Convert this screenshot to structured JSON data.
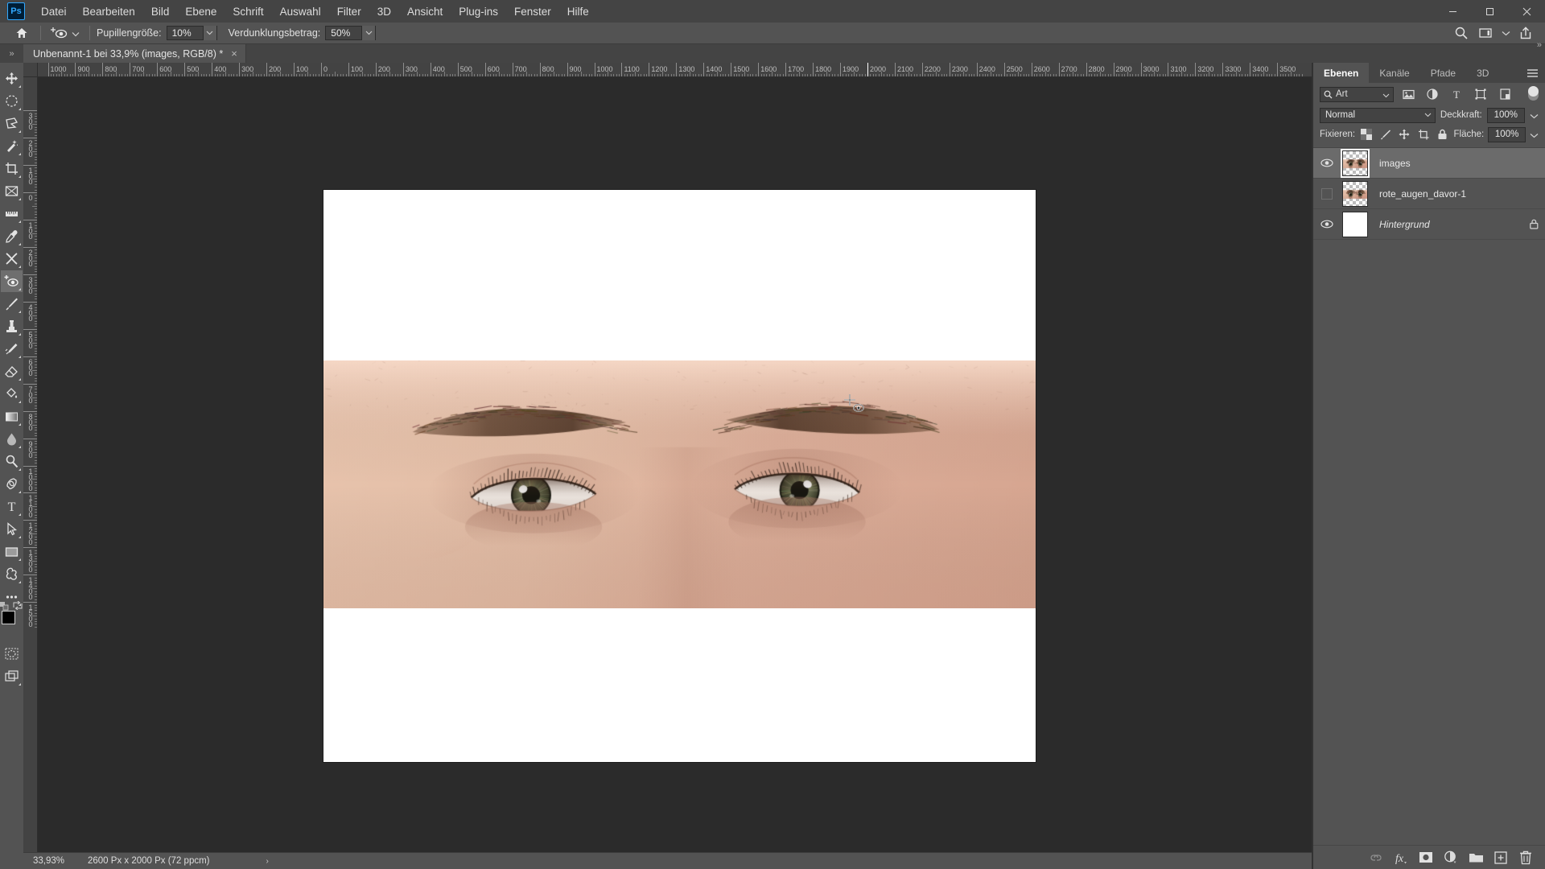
{
  "app": {
    "logo": "Ps",
    "menus": [
      "Datei",
      "Bearbeiten",
      "Bild",
      "Ebene",
      "Schrift",
      "Auswahl",
      "Filter",
      "3D",
      "Ansicht",
      "Plug-ins",
      "Fenster",
      "Hilfe"
    ],
    "window_controls": [
      "minimize",
      "maximize",
      "close"
    ]
  },
  "options_bar": {
    "home_icon": "home-icon",
    "tool_icon": "red-eye-tool-icon",
    "tool_preset_caret": "chevron-down-icon",
    "pupil_size_label": "Pupillengröße:",
    "pupil_size_value": "10%",
    "darken_label": "Verdunklungsbetrag:",
    "darken_value": "50%",
    "right_icons": [
      "search-icon",
      "workspace-icon",
      "chevron-down-icon",
      "share-icon"
    ]
  },
  "document_tab": {
    "title": "Unbenannt-1 bei 33,9% (images, RGB/8) *",
    "close": "×",
    "collapse_left": "»",
    "collapse_right": "»"
  },
  "toolbar": {
    "tools": [
      {
        "name": "move-tool",
        "glyph": "move",
        "active": false
      },
      {
        "name": "marquee-tool",
        "glyph": "marquee",
        "active": false
      },
      {
        "name": "lasso-tool",
        "glyph": "lasso",
        "active": false
      },
      {
        "name": "quick-selection-tool",
        "glyph": "wand",
        "active": false
      },
      {
        "name": "crop-tool",
        "glyph": "crop",
        "active": false
      },
      {
        "name": "frame-tool",
        "glyph": "frame",
        "active": false
      },
      {
        "name": "ruler-tool",
        "glyph": "ruler",
        "active": false
      },
      {
        "name": "eyedropper-tool",
        "glyph": "eyedropper",
        "active": false
      },
      {
        "name": "healing-brush-tool",
        "glyph": "heal",
        "active": false
      },
      {
        "name": "red-eye-tool",
        "glyph": "redeye",
        "active": true
      },
      {
        "name": "brush-tool",
        "glyph": "brush",
        "active": false
      },
      {
        "name": "clone-stamp-tool",
        "glyph": "stamp",
        "active": false
      },
      {
        "name": "history-brush-tool",
        "glyph": "historybrush",
        "active": false
      },
      {
        "name": "eraser-tool",
        "glyph": "eraser",
        "active": false
      },
      {
        "name": "gradient-tool",
        "glyph": "paintbucket",
        "active": false
      },
      {
        "name": "gradient-fill-tool",
        "glyph": "gradient",
        "active": false
      },
      {
        "name": "blur-tool",
        "glyph": "blur",
        "active": false
      },
      {
        "name": "dodge-tool",
        "glyph": "dodge",
        "active": false
      },
      {
        "name": "pen-tool",
        "glyph": "pen",
        "active": false
      },
      {
        "name": "type-tool",
        "glyph": "type",
        "active": false
      },
      {
        "name": "path-selection-tool",
        "glyph": "pathselect",
        "active": false
      },
      {
        "name": "rectangle-tool",
        "glyph": "rectangle",
        "active": false
      },
      {
        "name": "custom-shape-tool",
        "glyph": "shape",
        "active": false
      },
      {
        "name": "more-tools",
        "glyph": "ellipsis",
        "active": false
      }
    ],
    "foreground_color": "#000000",
    "background_color": "#5cf22a",
    "quickmask_name": "quick-mask-mode",
    "screenmode_name": "screen-mode"
  },
  "rulers": {
    "horizontal_labels": [
      "1000",
      "900",
      "800",
      "700",
      "600",
      "500",
      "400",
      "300",
      "200",
      "100",
      "0",
      "100",
      "200",
      "300",
      "400",
      "500",
      "600",
      "700",
      "800",
      "900",
      "1000",
      "1100",
      "1200",
      "1300",
      "1400",
      "1500",
      "1600",
      "1700",
      "1800",
      "1900",
      "2000",
      "2100",
      "2200",
      "2300",
      "2400",
      "2500",
      "2600",
      "2700",
      "2800",
      "2900",
      "3000",
      "3100",
      "3200",
      "3300",
      "3400",
      "3500"
    ],
    "vertical_labels": [
      "300",
      "200",
      "100",
      "0",
      "100",
      "200",
      "300",
      "400",
      "500",
      "600",
      "700",
      "800",
      "900",
      "1000",
      "1100",
      "1200",
      "1300",
      "1400",
      "1500"
    ],
    "unit": "Px"
  },
  "status_bar": {
    "zoom": "33,93%",
    "dimensions": "2600 Px x 2000 Px (72 ppcm)",
    "arrow": "›"
  },
  "panels": {
    "tabs": [
      {
        "label": "Ebenen",
        "active": true
      },
      {
        "label": "Kanäle",
        "active": false
      },
      {
        "label": "Pfade",
        "active": false
      },
      {
        "label": "3D",
        "active": false
      }
    ],
    "menu_icon": "panel-menu-icon",
    "filter": {
      "search_icon": "search-icon",
      "label": "Art",
      "caret": "chevron-down-icon",
      "kind_icons": [
        "pixel-layer-filter-icon",
        "adjustment-layer-filter-icon",
        "type-layer-filter-icon",
        "shape-layer-filter-icon",
        "smart-object-filter-icon"
      ],
      "toggle_name": "filter-toggle"
    },
    "blend": {
      "mode": "Normal",
      "opacity_label": "Deckkraft:",
      "opacity_value": "100%"
    },
    "lock": {
      "label": "Fixieren:",
      "icons": [
        "lock-transparency-icon",
        "lock-image-icon",
        "lock-position-icon",
        "lock-artboard-icon",
        "lock-all-icon"
      ],
      "fill_label": "Fläche:",
      "fill_value": "100%"
    },
    "layers": [
      {
        "name": "images",
        "visible": true,
        "selected": true,
        "locked": false,
        "italic": false,
        "thumb": "photo"
      },
      {
        "name": "rote_augen_davor-1",
        "visible": false,
        "selected": false,
        "locked": false,
        "italic": false,
        "thumb": "photo"
      },
      {
        "name": "Hintergrund",
        "visible": true,
        "selected": false,
        "locked": true,
        "italic": true,
        "thumb": "white"
      }
    ],
    "bottom_icons": [
      {
        "name": "link-layers-icon",
        "glyph": "link",
        "dim": true
      },
      {
        "name": "layer-style-icon",
        "glyph": "fx",
        "dim": false
      },
      {
        "name": "layer-mask-icon",
        "glyph": "mask",
        "dim": false
      },
      {
        "name": "adjustment-layer-icon",
        "glyph": "adj",
        "dim": false
      },
      {
        "name": "new-group-icon",
        "glyph": "folder",
        "dim": false
      },
      {
        "name": "new-layer-icon",
        "glyph": "newlayer",
        "dim": false
      },
      {
        "name": "delete-layer-icon",
        "glyph": "trash",
        "dim": false
      }
    ]
  },
  "canvas": {
    "artboard_bg": "#ffffff",
    "cursor_name": "red-eye-cursor",
    "photo_description": "close-up-of-eyes"
  }
}
